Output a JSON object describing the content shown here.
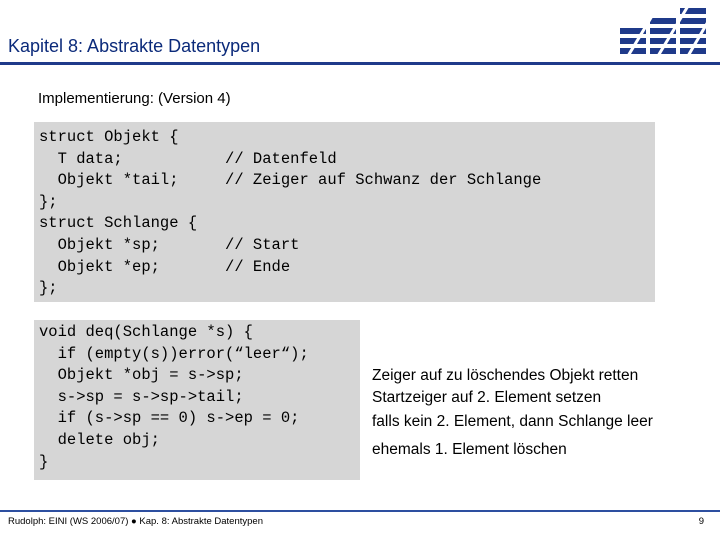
{
  "slide": {
    "title": "Kapitel 8: Abstrakte Datentypen",
    "subtitle": "Implementierung: (Version 4)"
  },
  "code": {
    "block1": "struct Objekt {\n  T data;           // Datenfeld\n  Objekt *tail;     // Zeiger auf Schwanz der Schlange\n};\nstruct Schlange {\n  Objekt *sp;       // Start\n  Objekt *ep;       // Ende\n};",
    "block2": "void deq(Schlange *s) {\n  if (empty(s))error(“leer“);\n  Objekt *obj = s->sp;\n  s->sp = s->sp->tail;\n  if (s->sp == 0) s->ep = 0;\n  delete obj;\n}"
  },
  "notes": [
    "Zeiger auf zu löschendes Objekt retten",
    "Startzeiger auf 2. Element setzen",
    "falls kein 2. Element, dann Schlange leer",
    "ehemals 1. Element löschen"
  ],
  "footer": {
    "left": "Rudolph: EINI (WS 2006/07)  ●  Kap. 8: Abstrakte Datentypen",
    "page": "9"
  },
  "colors": {
    "title": "#0b2a7a",
    "rule": "#1f3a8a",
    "code_bg": "#d6d6d6"
  }
}
